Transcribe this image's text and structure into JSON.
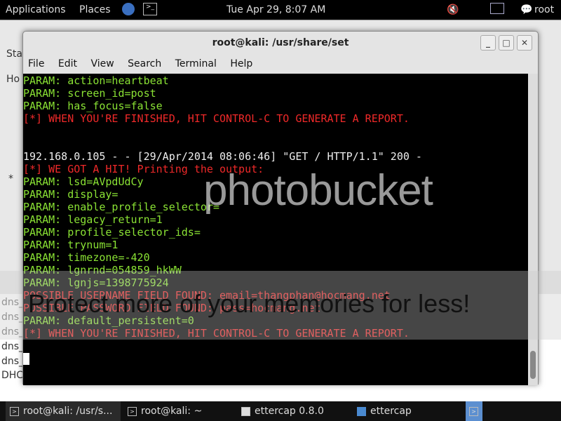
{
  "panel": {
    "applications": "Applications",
    "places": "Places",
    "clock": "Tue Apr 29,  8:07 AM",
    "user": "root"
  },
  "bg_window": {
    "tab_st": "Sta",
    "tab_ho": "Ho",
    "star": "*",
    "dns_lines": [
      "dns_",
      "dns_",
      "dns_",
      "dns_",
      "dns_"
    ],
    "dhc": "DHC"
  },
  "window": {
    "title": "root@kali: /usr/share/set",
    "menu": [
      "File",
      "Edit",
      "View",
      "Search",
      "Terminal",
      "Help"
    ]
  },
  "terminal_lines": [
    {
      "text": "PARAM: action=heartbeat",
      "color": "g"
    },
    {
      "text": "PARAM: screen_id=post",
      "color": "g"
    },
    {
      "text": "PARAM: has_focus=false",
      "color": "g"
    },
    {
      "text": "[*] WHEN YOU'RE FINISHED, HIT CONTROL-C TO GENERATE A REPORT.",
      "color": "r"
    },
    {
      "text": "",
      "color": "w"
    },
    {
      "text": "",
      "color": "w"
    },
    {
      "text": "192.168.0.105 - - [29/Apr/2014 08:06:46] \"GET / HTTP/1.1\" 200 -",
      "color": "w"
    },
    {
      "text": "[*] WE GOT A HIT! Printing the output:",
      "color": "r"
    },
    {
      "text": "PARAM: lsd=AVpdUdCy",
      "color": "g"
    },
    {
      "text": "PARAM: display=",
      "color": "g"
    },
    {
      "text": "PARAM: enable_profile_selector=",
      "color": "g"
    },
    {
      "text": "PARAM: legacy_return=1",
      "color": "g"
    },
    {
      "text": "PARAM: profile_selector_ids=",
      "color": "g"
    },
    {
      "text": "PARAM: trynum=1",
      "color": "g"
    },
    {
      "text": "PARAM: timezone=-420",
      "color": "g"
    },
    {
      "text": "PARAM: lgnrnd=054859_hkWW",
      "color": "g"
    },
    {
      "text": "PARAM: lgnjs=1398775924",
      "color": "g"
    },
    {
      "text": "POSSIBLE USERNAME FIELD FOUND: email=thangphan@hocmang.net",
      "color": "r"
    },
    {
      "text": "POSSIBLE PASSWORD FIELD FOUND: pass=hocmang.net",
      "color": "r"
    },
    {
      "text": "PARAM: default_persistent=0",
      "color": "g"
    },
    {
      "text": "[*] WHEN YOU'RE FINISHED, HIT CONTROL-C TO GENERATE A REPORT.",
      "color": "r"
    }
  ],
  "watermark": {
    "logo": "photobucket",
    "banner": "Protect more of your memories for less!"
  },
  "taskbar": [
    {
      "label": "root@kali: /usr/s...",
      "icon": "terminal-icon"
    },
    {
      "label": "root@kali: ~",
      "icon": "terminal-icon"
    },
    {
      "label": "ettercap 0.8.0",
      "icon": "window-icon"
    },
    {
      "label": "ettercap",
      "icon": "folder-icon"
    }
  ]
}
